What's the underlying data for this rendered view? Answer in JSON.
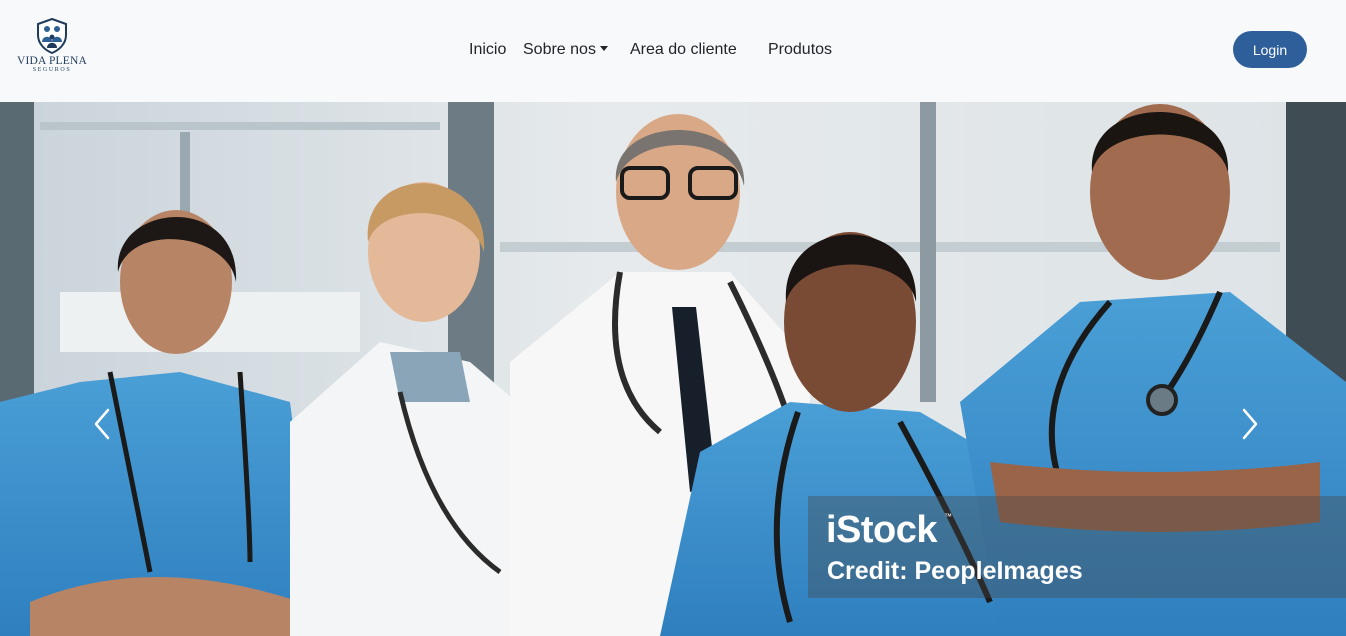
{
  "brand": {
    "name": "VIDA PLENA",
    "subtitle": "SEGUROS",
    "logo_icon": "family-shield-icon",
    "color": "#1f3b5c"
  },
  "nav": {
    "inicio": "Inicio",
    "sobre_nos": "Sobre nos",
    "area_cliente": "Area do cliente",
    "produtos": "Produtos"
  },
  "login": {
    "label": "Login",
    "color": "#2f5f9a"
  },
  "hero": {
    "image_subject": "group of smiling healthcare professionals",
    "watermark_brand": "iStock",
    "watermark_tm": "™",
    "watermark_credit": "Credit: PeopleImages",
    "prev_icon": "chevron-left-icon",
    "next_icon": "chevron-right-icon"
  }
}
